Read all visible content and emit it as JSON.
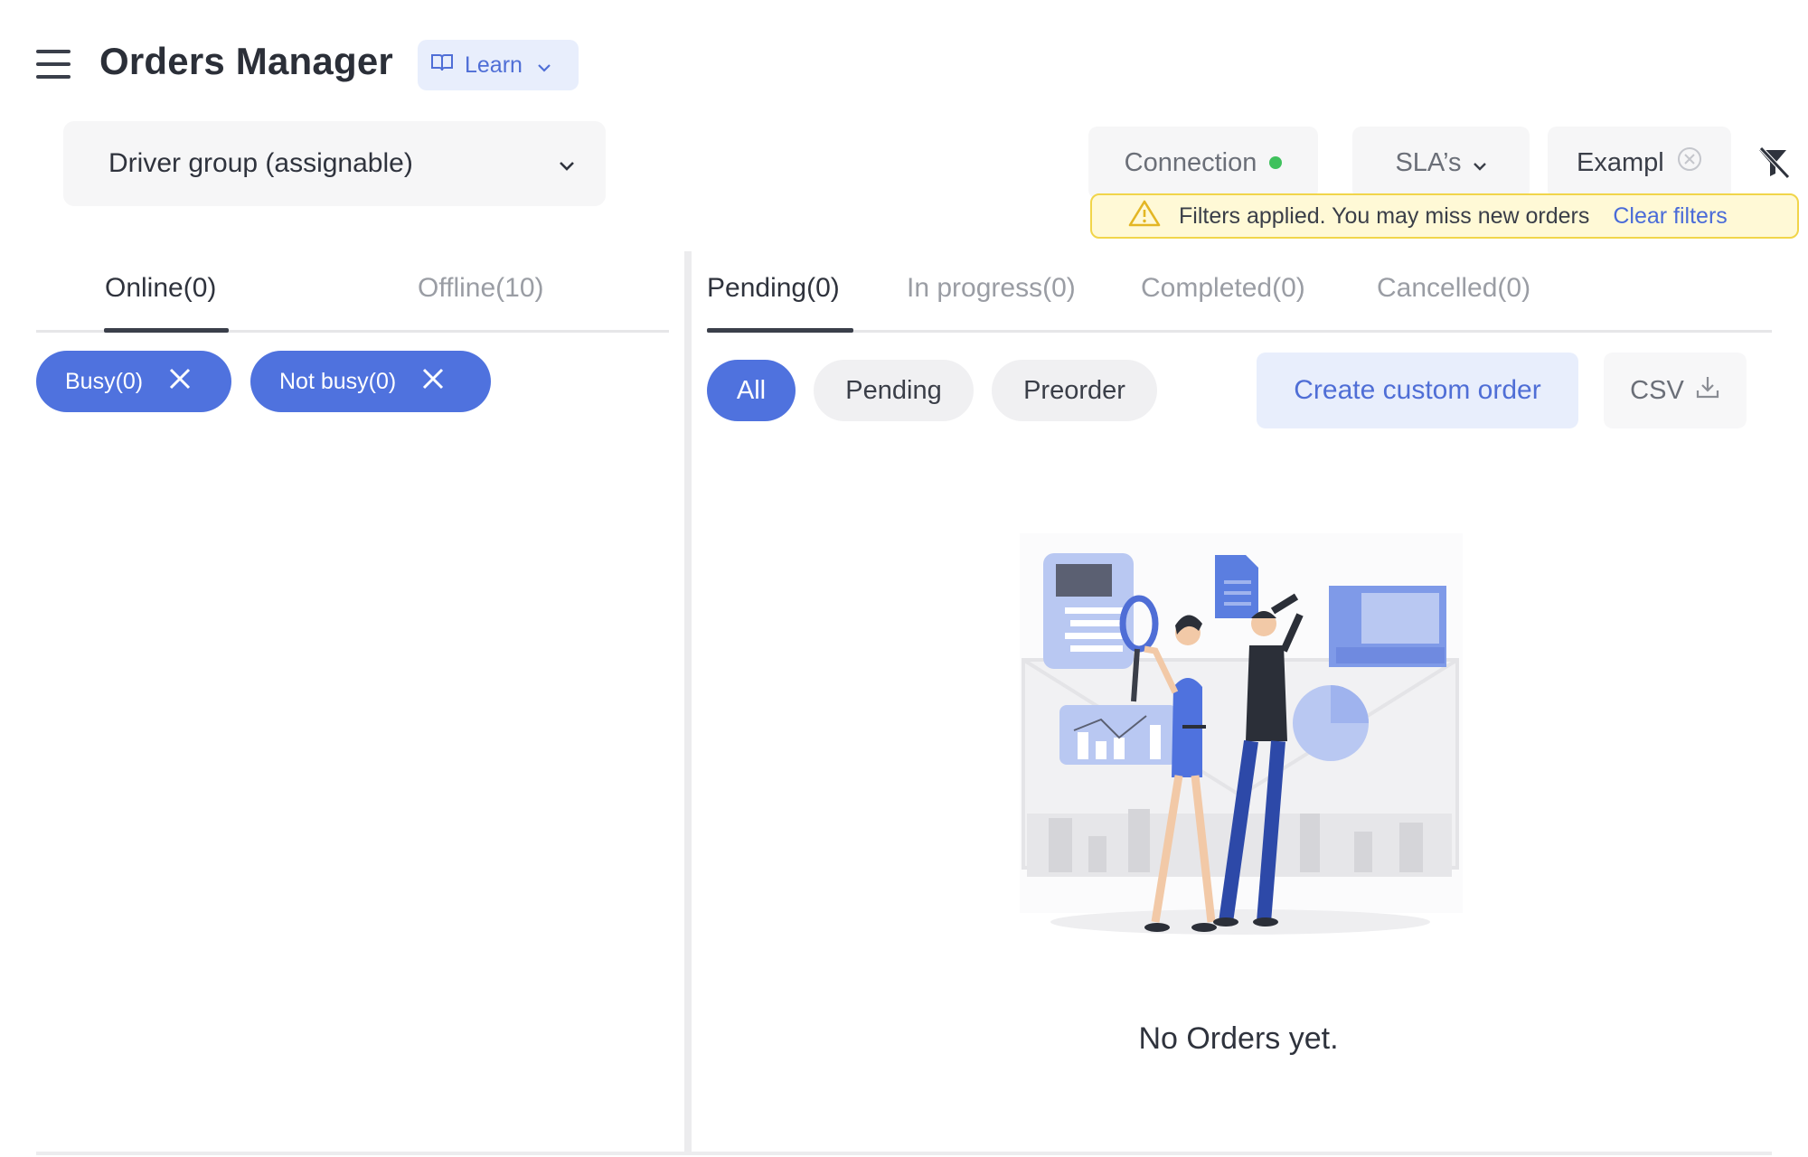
{
  "header": {
    "title": "Orders Manager",
    "learn_label": "Learn"
  },
  "driver_group": {
    "selected": "Driver group (assignable)"
  },
  "status_controls": {
    "connection_label": "Connection",
    "connection_color": "#3fc15d",
    "sla_label": "SLA’s",
    "example_value": "Example"
  },
  "warning": {
    "text": "Filters applied. You may miss new orders",
    "clear_label": "Clear filters"
  },
  "left_panel": {
    "tabs": [
      {
        "label": "Online(0)",
        "active": true
      },
      {
        "label": "Offline(10)",
        "active": false
      }
    ],
    "chips": [
      {
        "label": "Busy(0)"
      },
      {
        "label": "Not busy(0)"
      }
    ]
  },
  "right_panel": {
    "tabs": [
      {
        "label": "Pending(0)",
        "active": true
      },
      {
        "label": "In progress(0)",
        "active": false
      },
      {
        "label": "Completed(0)",
        "active": false
      },
      {
        "label": "Cancelled(0)",
        "active": false
      }
    ],
    "filters": [
      {
        "label": "All",
        "selected": true
      },
      {
        "label": "Pending",
        "selected": false
      },
      {
        "label": "Preorder",
        "selected": false
      }
    ],
    "create_label": "Create custom order",
    "csv_label": "CSV",
    "empty_message": "No Orders yet."
  },
  "colors": {
    "accent": "#4f72de",
    "accent_light": "#e8eefc",
    "warning_bg": "#fff9d6",
    "warning_border": "#f1d54a"
  }
}
